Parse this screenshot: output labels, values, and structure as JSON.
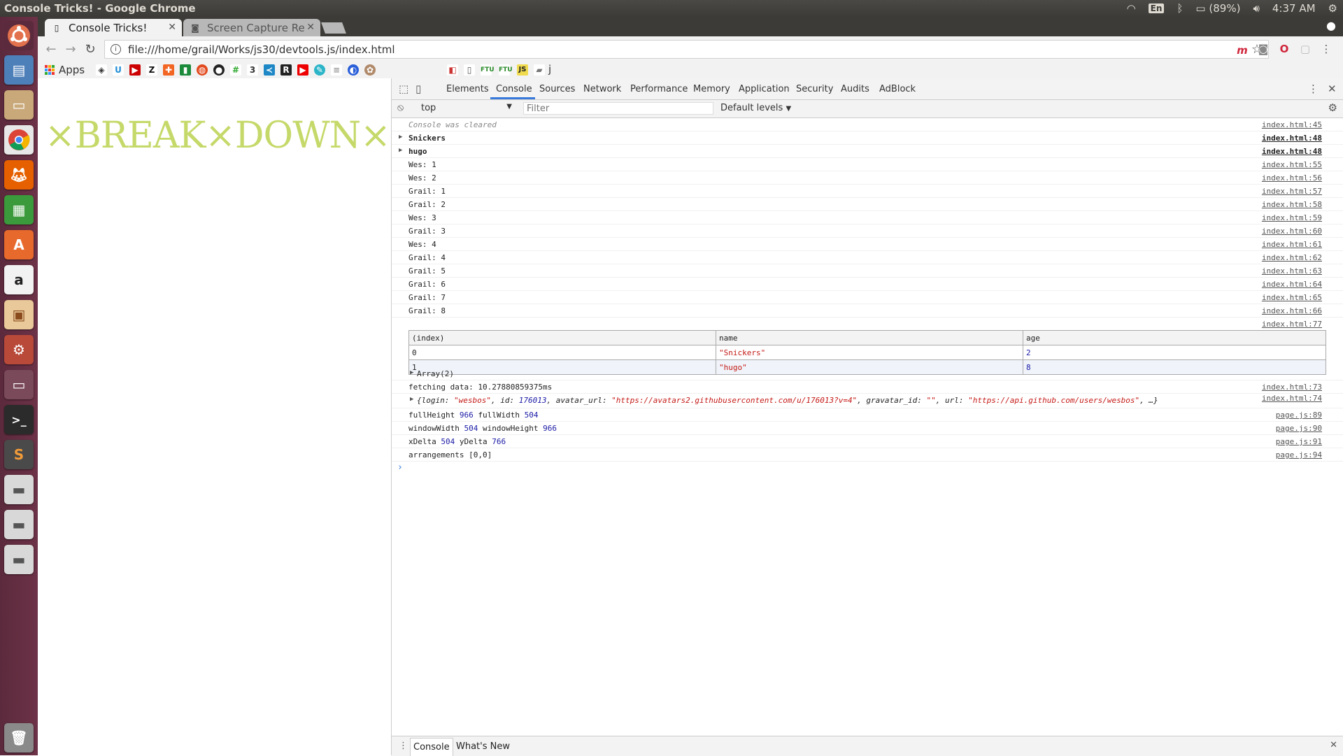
{
  "os": {
    "window_title": "Console Tricks! - Google Chrome",
    "keyboard": "En",
    "battery": "(89%)",
    "time": "4:37 AM"
  },
  "browser": {
    "tabs": [
      {
        "label": "Console Tricks!",
        "active": true
      },
      {
        "label": "Screen Capture Re",
        "active": false
      }
    ],
    "url": "file:///home/grail/Works/js30/devtools.js/index.html",
    "bookmarks": {
      "apps_label": "Apps",
      "folder_label": "j"
    }
  },
  "page": {
    "headline": "×BREAK×DOWN×",
    "headline_color": "#c5d96a"
  },
  "devtools": {
    "tabs": [
      "Elements",
      "Console",
      "Sources",
      "Network",
      "Performance",
      "Memory",
      "Application",
      "Security",
      "Audits",
      "AdBlock"
    ],
    "active_tab": "Console",
    "context": "top",
    "filter_placeholder": "Filter",
    "levels": "Default levels",
    "drawer_tabs": [
      "Console",
      "What's New"
    ],
    "accent": "#3879d9"
  },
  "console": {
    "lines": [
      {
        "text": "Console was cleared",
        "src": "index.html:45"
      },
      {
        "text": "Snickers",
        "src": "index.html:48"
      },
      {
        "text": "hugo",
        "src": "index.html:48"
      },
      {
        "text": "Wes: 1",
        "src": "index.html:55"
      },
      {
        "text": "Wes: 2",
        "src": "index.html:56"
      },
      {
        "text": "Grail: 1",
        "src": "index.html:57"
      },
      {
        "text": "Grail: 2",
        "src": "index.html:58"
      },
      {
        "text": "Wes: 3",
        "src": "index.html:59"
      },
      {
        "text": "Grail: 3",
        "src": "index.html:60"
      },
      {
        "text": "Wes: 4",
        "src": "index.html:61"
      },
      {
        "text": "Grail: 4",
        "src": "index.html:62"
      },
      {
        "text": "Grail: 5",
        "src": "index.html:63"
      },
      {
        "text": "Grail: 6",
        "src": "index.html:64"
      },
      {
        "text": "Grail: 7",
        "src": "index.html:65"
      },
      {
        "text": "Grail: 8",
        "src": "index.html:66"
      }
    ],
    "table_src": "index.html:77",
    "table": {
      "headers": [
        "(index)",
        "name",
        "age"
      ],
      "rows": [
        [
          "0",
          "\"Snickers\"",
          "2"
        ],
        [
          "1",
          "\"hugo\"",
          "8"
        ]
      ],
      "footer": "Array(2)"
    },
    "fetching": {
      "text": "fetching data: 10.27880859375ms",
      "src": "index.html:73"
    },
    "object": {
      "open": "{login: ",
      "login": "\"wesbos\"",
      "id_key": ", id: ",
      "id": "176013",
      "avatar_key": ", avatar_url: ",
      "avatar": "\"https://avatars2.githubusercontent.com/u/176013?v=4\"",
      "gravatar_key": ", gravatar_id: ",
      "gravatar": "\"\"",
      "url_key": ", url: ",
      "url": "\"https://api.github.com/users/wesbos\"",
      "close": ", …}",
      "src": "index.html:74"
    },
    "pagejs": [
      {
        "k1": "fullHeight",
        "v1": "966",
        "k2": "fullWidth",
        "v2": "504",
        "src": "page.js:89"
      },
      {
        "k1": "windowWidth",
        "v1": "504",
        "k2": "windowHeight",
        "v2": "966",
        "src": "page.js:90"
      },
      {
        "k1": "xDelta",
        "v1": "504",
        "k2": "yDelta",
        "v2": "766",
        "src": "page.js:91"
      }
    ],
    "arrangements": {
      "text": "arrangements [0,0]",
      "src": "page.js:94"
    }
  }
}
